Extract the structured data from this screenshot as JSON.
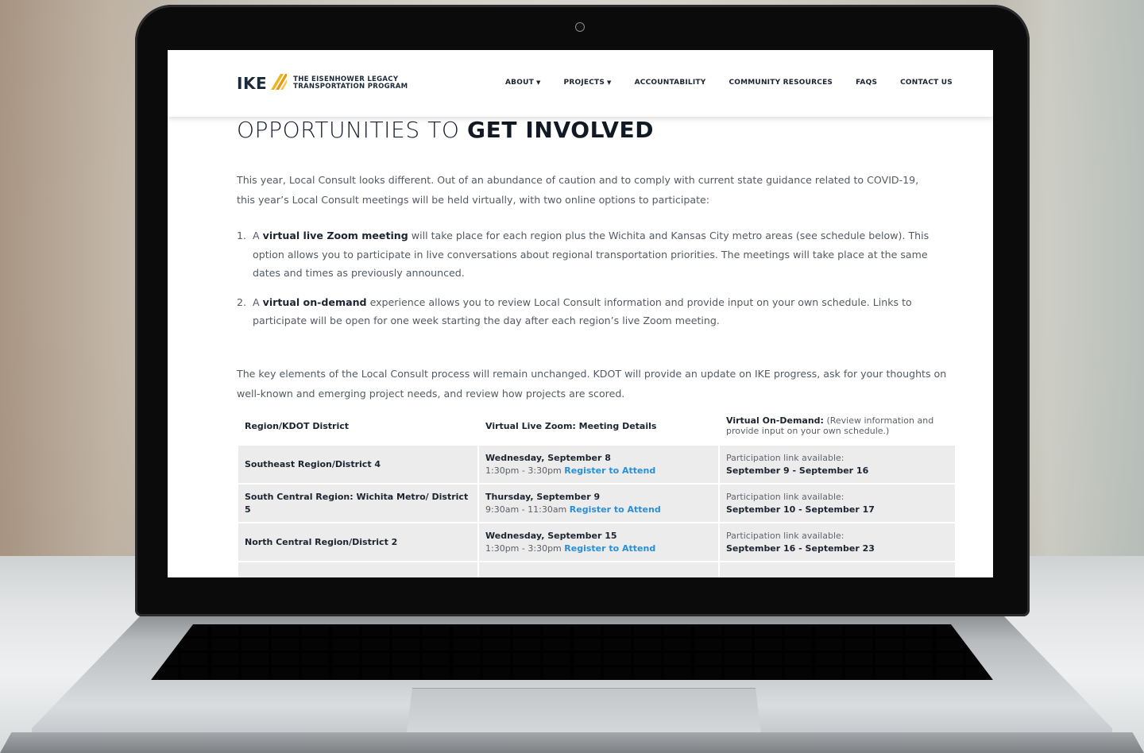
{
  "header": {
    "logo_word": "IKE",
    "logo_tag_line1": "THE EISENHOWER LEGACY",
    "logo_tag_line2": "TRANSPORTATION PROGRAM",
    "nav": [
      {
        "label": "ABOUT",
        "dropdown": true
      },
      {
        "label": "PROJECTS",
        "dropdown": true
      },
      {
        "label": "ACCOUNTABILITY",
        "dropdown": false
      },
      {
        "label": "COMMUNITY RESOURCES",
        "dropdown": false
      },
      {
        "label": "FAQS",
        "dropdown": false
      },
      {
        "label": "CONTACT US",
        "dropdown": false
      }
    ]
  },
  "main": {
    "title_light": "OPPORTUNITIES TO ",
    "title_bold": "GET INVOLVED",
    "intro": "This year, Local Consult looks different. Out of an abundance of caution and to comply with current state guidance related to COVID-19, this year’s Local Consult meetings will be held virtually, with two online options to participate:",
    "options": [
      {
        "num": "1.",
        "pre": "A ",
        "bold": "virtual live Zoom meeting",
        "post": " will take place for each region plus the Wichita and Kansas City metro areas (see schedule below). This option allows you to participate in live conversations about regional transportation priorities. The meetings will take place at the same dates and times as previously announced."
      },
      {
        "num": "2.",
        "pre": "A ",
        "bold": "virtual on-demand",
        "post": " experience allows you to review Local Consult information and provide input on your own schedule. Links to participate will be open for one week starting the day after each region’s live Zoom meeting."
      }
    ],
    "closing": "The key elements of the Local Consult process will remain unchanged. KDOT will provide an update on IKE progress, ask for your thoughts on well-known and emerging project needs, and review how projects are scored."
  },
  "table": {
    "headers": {
      "col1": "Region/KDOT District",
      "col2": "Virtual Live Zoom: Meeting Details",
      "col3_bold": "Virtual On-Demand:",
      "col3_note": " (Review information and provide input on your own schedule.)"
    },
    "register_label": "Register to Attend",
    "avail_label": "Participation link available:",
    "rows": [
      {
        "region": "Southeast Region/District 4",
        "date": "Wednesday, September 8",
        "time": "1:30pm - 3:30pm ",
        "range": "September 9 - September 16"
      },
      {
        "region": "South Central Region: Wichita Metro/ District 5",
        "date": "Thursday, September 9",
        "time": "9:30am - 11:30am ",
        "range": "September 10 - September 17"
      },
      {
        "region": "North Central Region/District 2",
        "date": "Wednesday, September 15",
        "time": "1:30pm - 3:30pm ",
        "range": "September 16 - September 23"
      }
    ]
  },
  "colors": {
    "brand_navy": "#1b2a3a",
    "brand_gold": "#f2b21b",
    "link_blue": "#2a8fd6"
  }
}
